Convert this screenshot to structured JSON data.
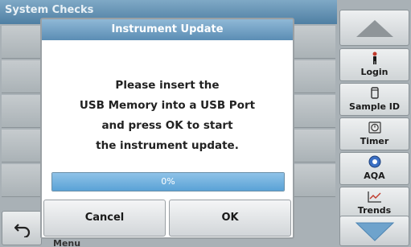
{
  "screen": {
    "title": "System Checks",
    "menu_label": "Menu"
  },
  "sidebar": {
    "items": [
      {
        "label": "Login",
        "icon": "person-icon"
      },
      {
        "label": "Sample ID",
        "icon": "sample-vial-icon"
      },
      {
        "label": "Timer",
        "icon": "timer-icon"
      },
      {
        "label": "AQA",
        "icon": "aqa-icon"
      },
      {
        "label": "Trends",
        "icon": "trends-icon"
      }
    ]
  },
  "dialog": {
    "title": "Instrument Update",
    "message_lines": [
      "Please insert the",
      "USB Memory into a USB Port",
      "and press OK to start",
      "the instrument update."
    ],
    "progress_percent": 0,
    "progress_label": "0%",
    "cancel_label": "Cancel",
    "ok_label": "OK"
  },
  "colors": {
    "title_bar": "#5b8db4",
    "progress_fill": "#5aa2d6",
    "arrow_fill": "#6ea3cc"
  }
}
